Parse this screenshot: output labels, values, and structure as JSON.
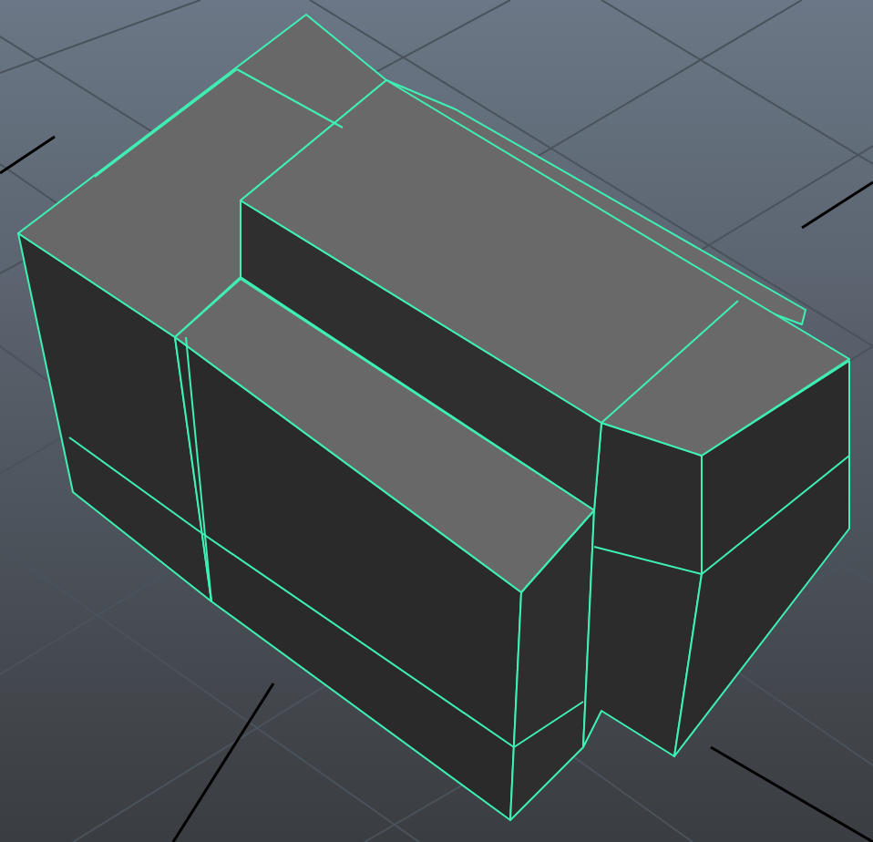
{
  "viewport": {
    "selected": true
  }
}
